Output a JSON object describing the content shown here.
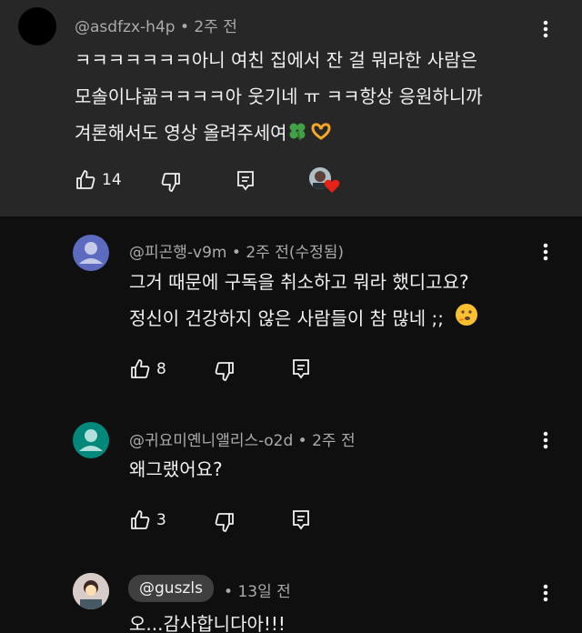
{
  "comments": [
    {
      "author": "@asdfzx-h4p",
      "time": "2주 전",
      "lines": [
        "ㅋㅋㅋㅋㅋㅋㅋ아니 여친 집에서 잔 걸 뭐라한 사람은",
        "모솔이냐곪ㅋㅋㅋㅋ아 웃기네 ㅠ ㅋㅋ항상 응원하니까",
        "겨론해서도 영상 올려주세여"
      ],
      "likes": "14",
      "creator_heart": true
    },
    {
      "author": "@피곤행-v9m",
      "time": "2주 전(수정됨)",
      "lines": [
        "그거 때문에 구독을 취소하고 뭐라 했디고요?",
        "정신이 건강하지 않은 사람들이 참 많네 ;;"
      ],
      "likes": "8"
    },
    {
      "author": "@귀요미옌니앨리스-o2d",
      "time": "2주 전",
      "lines": [
        "왜그랬어요?"
      ],
      "likes": "3"
    },
    {
      "mention": "@guszls",
      "time": "13일 전",
      "lines": [
        "오...감사합니다아!!!"
      ]
    }
  ],
  "separator": "•",
  "colors": {
    "top_bg": "#272727",
    "thread_bg": "#0f0f0f",
    "meta_text": "#aaaaaa",
    "avatar_purple": "#5c6bc0",
    "avatar_teal": "#00897b",
    "heart": "#e62117"
  },
  "icons": [
    "thumb-up-icon",
    "thumb-down-icon",
    "reply-icon",
    "more-vert-icon",
    "four-leaf-clover-emoji",
    "heart-hands-emoji",
    "thinking-face-emoji",
    "creator-heart-icon"
  ]
}
